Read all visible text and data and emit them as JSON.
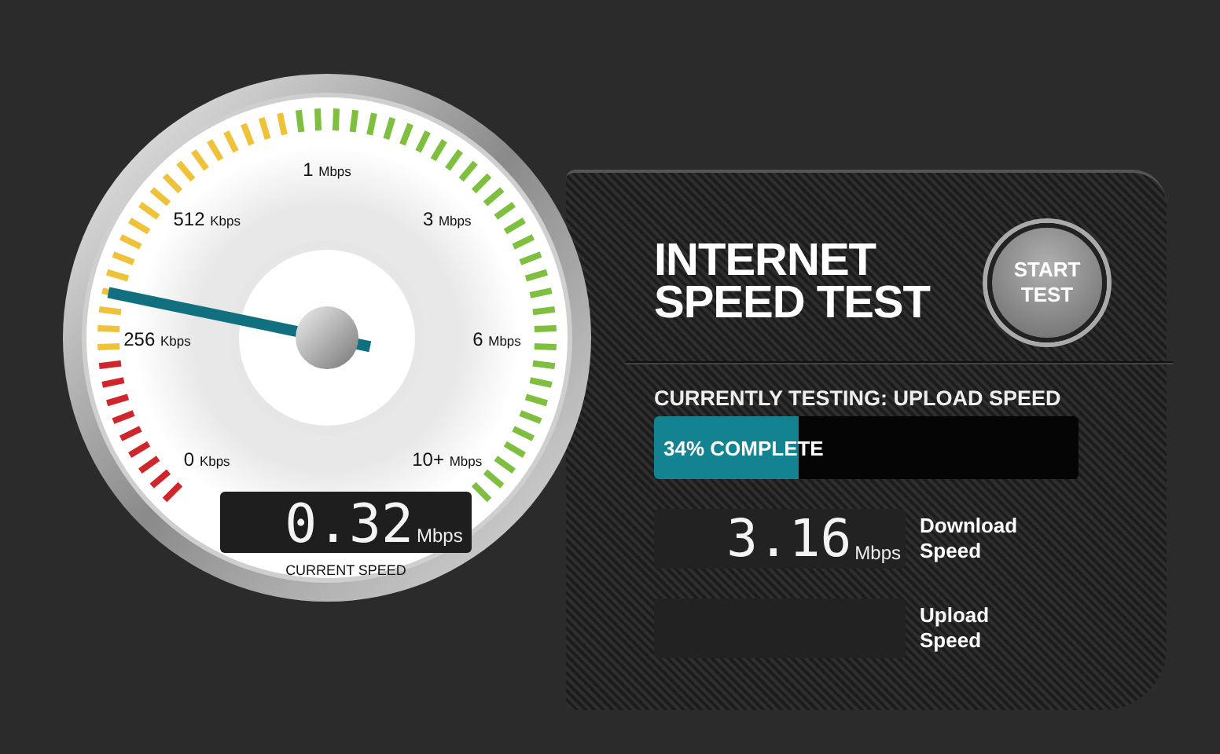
{
  "gauge": {
    "level": 0.21,
    "scale": [
      {
        "value": "0",
        "unit": "Kbps"
      },
      {
        "value": "256",
        "unit": "Kbps"
      },
      {
        "value": "512",
        "unit": "Kbps"
      },
      {
        "value": "1",
        "unit": "Mbps"
      },
      {
        "value": "3",
        "unit": "Mbps"
      },
      {
        "value": "6",
        "unit": "Mbps"
      },
      {
        "value": "10+",
        "unit": "Mbps"
      }
    ],
    "reading": "0.32",
    "unit": "Mbps",
    "caption": "CURRENT SPEED"
  },
  "panel": {
    "title": [
      "INTERNET",
      "SPEED TEST"
    ],
    "start_button": [
      "START",
      "TEST"
    ],
    "status": "CURRENTLY TESTING: UPLOAD SPEED",
    "progress": {
      "level": 0.34,
      "label": "34% COMPLETE"
    },
    "results": [
      {
        "reading": "3.16",
        "unit": "Mbps",
        "label": [
          "Download",
          "Speed"
        ]
      },
      {
        "label": [
          "Upload",
          "Speed"
        ]
      }
    ]
  }
}
